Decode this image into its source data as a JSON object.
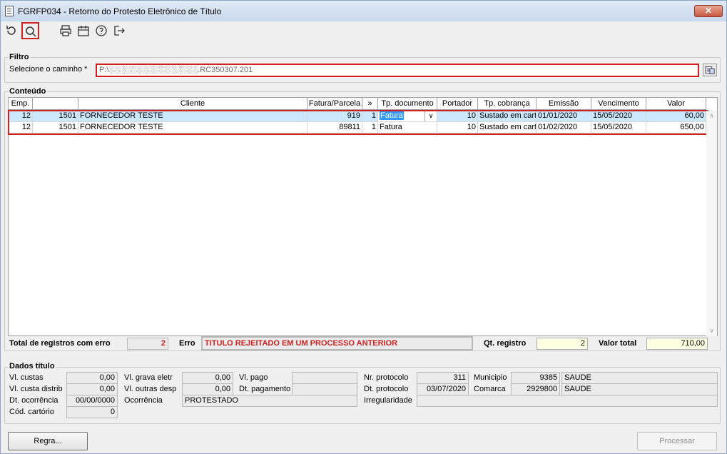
{
  "window": {
    "title": "FGRFP034 - Retorno do Protesto Eletrônico de Título",
    "close_label": "✕"
  },
  "toolbar": {
    "items": [
      {
        "name": "refresh-icon"
      },
      {
        "name": "search-icon"
      },
      {
        "name": "print-icon"
      },
      {
        "name": "calendar-icon"
      },
      {
        "name": "help-icon"
      },
      {
        "name": "exit-icon"
      }
    ]
  },
  "filtro": {
    "title": "Filtro",
    "path_label": "Selecione o caminho *",
    "path_value": "P:\\░░░░░░░░░░░░░░░░.RC350307.201"
  },
  "conteudo": {
    "title": "Conteúdo",
    "columns": [
      "Emp.",
      "",
      "Cliente",
      "Fatura/Parcela",
      "»",
      "Tp. documento",
      "Portador",
      "Tp. cobrança",
      "Emissão",
      "Vencimento",
      "Valor"
    ],
    "rows": [
      {
        "emp": "12",
        "code": "1501",
        "cliente": "FORNECEDOR TESTE",
        "fatura": "919",
        "parcela": "1",
        "tp_documento": "Fatura",
        "portador": "10",
        "tp_cobranca": "Sustado em cart",
        "emissao": "01/01/2020",
        "vencimento": "15/05/2020",
        "valor": "60,00"
      },
      {
        "emp": "12",
        "code": "1501",
        "cliente": "FORNECEDOR TESTE",
        "fatura": "89811",
        "parcela": "1",
        "tp_documento": "Fatura",
        "portador": "10",
        "tp_cobranca": "Sustado em cart",
        "emissao": "01/02/2020",
        "vencimento": "15/05/2020",
        "valor": "650,00"
      }
    ],
    "total_erro_label": "Total de registros com erro",
    "total_erro_value": "2",
    "erro_label": "Erro",
    "erro_value": "TITULO REJEITADO EM UM PROCESSO ANTERIOR",
    "qt_registro_label": "Qt. registro",
    "qt_registro_value": "2",
    "valor_total_label": "Valor total",
    "valor_total_value": "710,00"
  },
  "dados": {
    "title": "Dados título",
    "vl_custas_label": "Vl. custas",
    "vl_custas": "0,00",
    "vl_custa_distrib_label": "Vl. custa distrib",
    "vl_custa_distrib": "0,00",
    "dt_ocorrencia_label": "Dt. ocorrência",
    "dt_ocorrencia": "00/00/0000",
    "cod_cartorio_label": "Cód. cartório",
    "cod_cartorio": "0",
    "vl_grava_eletr_label": "Vl. grava eletr",
    "vl_grava_eletr": "0,00",
    "vl_outras_desp_label": "Vl. outras desp",
    "vl_outras_desp": "0,00",
    "ocorrencia_label": "Ocorrência",
    "ocorrencia": "PROTESTADO",
    "vl_pago_label": "Vl. pago",
    "vl_pago": "",
    "dt_pagamento_label": "Dt. pagamento",
    "dt_pagamento": "",
    "nr_protocolo_label": "Nr. protocolo",
    "nr_protocolo": "311",
    "dt_protocolo_label": "Dt. protocolo",
    "dt_protocolo": "03/07/2020",
    "irregularidade_label": "Irregularidade",
    "irregularidade": "",
    "municipio_label": "Municipio",
    "municipio_code": "9385",
    "municipio_name": "SAUDE",
    "comarca_label": "Comarca",
    "comarca_code": "2929800",
    "comarca_name": "SAUDE"
  },
  "buttons": {
    "regra": "Regra...",
    "processar": "Processar"
  }
}
